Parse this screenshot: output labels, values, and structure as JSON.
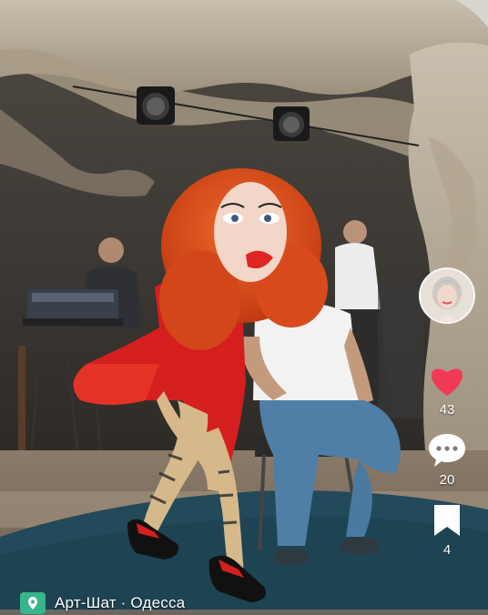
{
  "video": {
    "description": "Video frame: performer in large doll mask with red curly wig and red dress dancing near a seated man in a white t-shirt, under a stone grotto stage with lights and a DJ"
  },
  "actions": {
    "likes": {
      "icon": "heart-icon",
      "count": "43",
      "color": "#f23a56"
    },
    "comments": {
      "icon": "speech-bubble-icon",
      "count": "20"
    },
    "saves": {
      "icon": "bookmark-icon",
      "count": "4"
    }
  },
  "footer": {
    "app_badge_icon": "pin-icon",
    "channel": "Арт-Шат · Одесса"
  },
  "colors": {
    "accent_green": "#36b68a",
    "heart": "#f23a56"
  }
}
